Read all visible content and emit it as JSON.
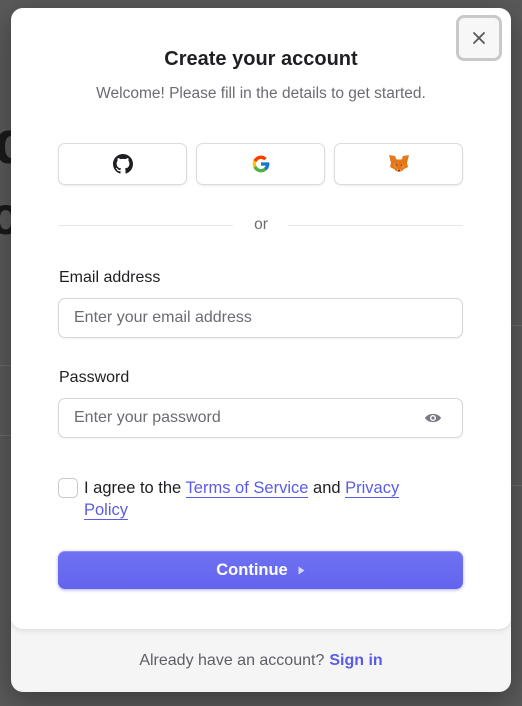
{
  "modal": {
    "title": "Create your account",
    "subtitle": "Welcome! Please fill in the details to get started.",
    "close_icon": "close-icon"
  },
  "social": [
    {
      "provider": "GitHub",
      "icon": "github-icon"
    },
    {
      "provider": "Google",
      "icon": "google-icon"
    },
    {
      "provider": "MetaMask",
      "icon": "metamask-fox-icon"
    }
  ],
  "divider": {
    "text": "or"
  },
  "email": {
    "label": "Email address",
    "placeholder": "Enter your email address",
    "value": ""
  },
  "password": {
    "label": "Password",
    "placeholder": "Enter your password",
    "value": "",
    "toggle_icon": "eye-icon"
  },
  "terms": {
    "checked": false,
    "prefix": "I agree to the",
    "terms_link": "Terms of Service",
    "connector": "and",
    "privacy_link": "Privacy Policy"
  },
  "continue": {
    "label": "Continue",
    "icon": "caret-right-icon"
  },
  "footer": {
    "prompt": "Already have an account?",
    "signin_link": "Sign in"
  },
  "colors": {
    "accent": "#6366f1",
    "link": "#5b5ce6",
    "text": "#1f1f23",
    "muted": "#6b6b72"
  }
}
